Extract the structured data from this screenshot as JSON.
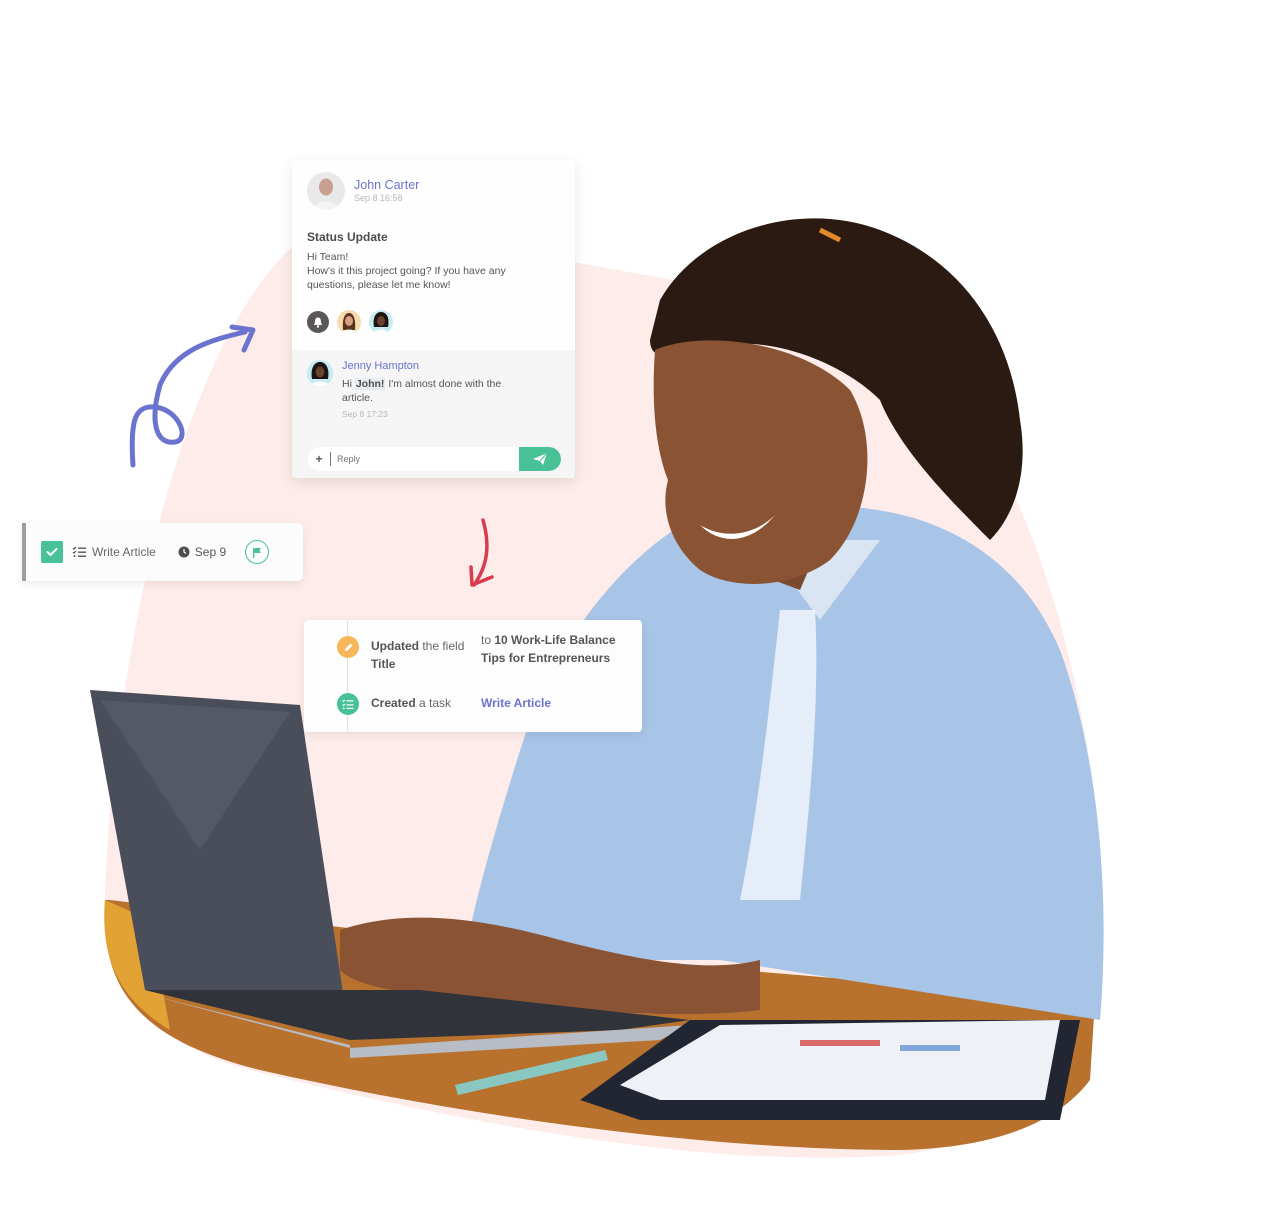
{
  "chat": {
    "author": {
      "name": "John Carter",
      "timestamp": "Sep 8  16:58",
      "avatar": "avatar-john-carter"
    },
    "title": "Status Update",
    "body_line1": "Hi Team!",
    "body_line2": "How's it this project going? If you have any questions, please let me know!",
    "watchers": [
      "bell-icon",
      "avatar-watcher-1",
      "avatar-watcher-2"
    ],
    "reply": {
      "author": "Jenny Hampton",
      "greeting": "Hi",
      "mention": "John!",
      "text": " I'm almost done with the article.",
      "timestamp": "Sep 8  17:23"
    },
    "input": {
      "plus_label": "+",
      "placeholder": "Reply",
      "send_icon": "paper-plane-icon"
    }
  },
  "task": {
    "name": "Write Article",
    "due_date": "Sep 9",
    "completed": true,
    "icons": [
      "checkbox-icon",
      "checklist-icon",
      "clock-icon",
      "flag-icon"
    ]
  },
  "activity": [
    {
      "icon": "pencil-icon",
      "action": "Updated",
      "mid": " the field ",
      "field": "Title",
      "to_prefix": "to ",
      "value": "10 Work-Life Balance Tips for Entrepreneurs"
    },
    {
      "icon": "checklist-icon",
      "action": "Created",
      "mid": "  a task",
      "link": "Write Article"
    }
  ],
  "colors": {
    "accent_blue": "#6a74cf",
    "accent_green": "#48c196",
    "accent_orange": "#f7b65a",
    "arrow_red": "#d83a4e",
    "blob_pink": "#fdecea"
  }
}
